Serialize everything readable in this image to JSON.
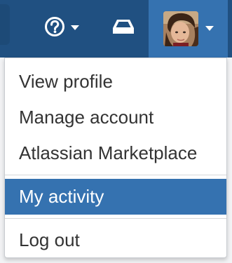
{
  "colors": {
    "header_bg": "#205081",
    "user_trigger_bg": "#3572b0",
    "active_item_bg": "#3572b0",
    "menu_text": "#333333",
    "active_text": "#ffffff"
  },
  "header": {
    "help": {
      "icon": "question-circle-icon",
      "caret": "chevron-down-icon"
    },
    "inbox": {
      "icon": "inbox-icon"
    },
    "user": {
      "avatar": "avatar",
      "caret": "chevron-down-icon"
    }
  },
  "user_menu": {
    "groups": [
      {
        "items": [
          "View profile",
          "Manage account",
          "Atlassian Marketplace"
        ]
      },
      {
        "items": [
          "My activity"
        ],
        "active": "My activity"
      },
      {
        "items": [
          "Log out"
        ]
      }
    ]
  }
}
